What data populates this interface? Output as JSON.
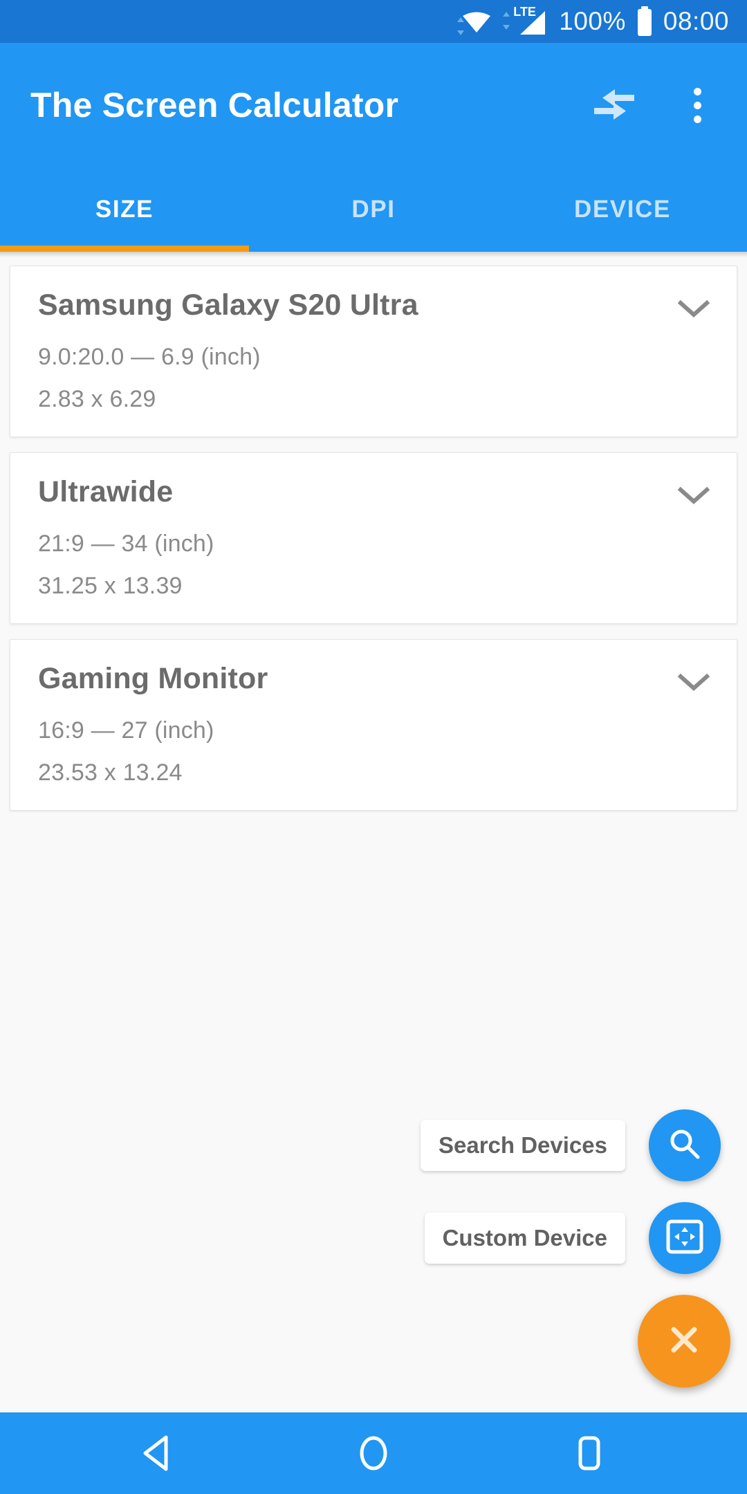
{
  "status_bar": {
    "wifi_icon": "wifi-icon",
    "network_type": "LTE",
    "signal_icon": "signal-bars-icon",
    "battery_percent": "100%",
    "battery_icon": "battery-full-icon",
    "time": "08:00"
  },
  "app_bar": {
    "title": "The Screen Calculator",
    "compare_icon": "compare-arrows-icon",
    "overflow_icon": "more-vert-icon"
  },
  "tabs": {
    "items": [
      {
        "label": "SIZE",
        "active": true
      },
      {
        "label": "DPI",
        "active": false
      },
      {
        "label": "DEVICE",
        "active": false
      }
    ],
    "indicator_color": "#f39c12"
  },
  "cards": [
    {
      "title": "Samsung Galaxy S20 Ultra",
      "ratio_line": "9.0:20.0  —  6.9 (inch)",
      "dimensions": "2.83 x 6.29",
      "expand_icon": "chevron-down-icon"
    },
    {
      "title": "Ultrawide",
      "ratio_line": "21:9  —  34 (inch)",
      "dimensions": "31.25 x 13.39",
      "expand_icon": "chevron-down-icon"
    },
    {
      "title": "Gaming Monitor",
      "ratio_line": "16:9  —  27 (inch)",
      "dimensions": "23.53 x 13.24",
      "expand_icon": "chevron-down-icon"
    }
  ],
  "speed_dial": {
    "expanded": true,
    "actions": [
      {
        "label": "Search Devices",
        "icon": "search-icon",
        "color": "#2196f3"
      },
      {
        "label": "Custom Device",
        "icon": "resize-screen-icon",
        "color": "#2196f3"
      }
    ],
    "main": {
      "icon": "close-icon",
      "color": "#f7941d"
    }
  },
  "nav_bar": {
    "back_icon": "back-triangle-icon",
    "home_icon": "home-circle-icon",
    "recents_icon": "recents-square-icon"
  },
  "colors": {
    "status_bar": "#1976d2",
    "app_bar": "#2196f3",
    "accent": "#f39c12",
    "background": "#f9f9f9",
    "card": "#ffffff"
  }
}
